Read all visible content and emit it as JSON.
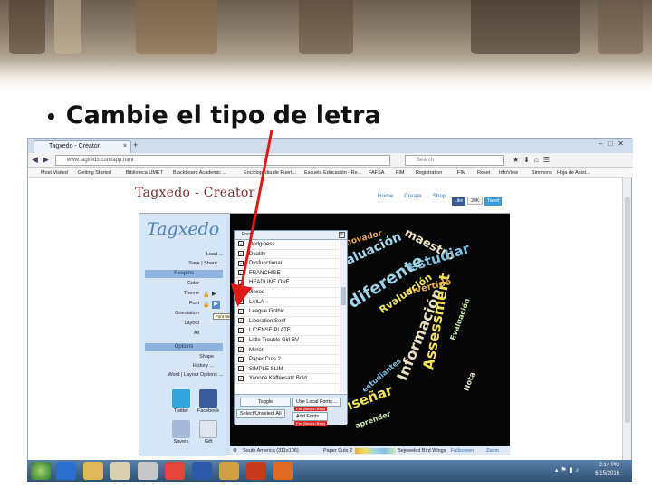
{
  "slide": {
    "bullet": "•",
    "title": "Cambie el tipo de letra"
  },
  "browser": {
    "tab_title": "Tagxedo - Creator",
    "tab_close": "×",
    "new_tab": "+",
    "url": "www.tagxedo.com/app.html",
    "search_placeholder": "Search",
    "bookmarks": [
      "Most Visited",
      "Getting Started",
      "Biblioteca UMET",
      "Blackboard Academic ...",
      "Enciclopedia de Puert...",
      "Escuela Educación - Re...",
      "FAFSA",
      "FIM",
      "Registration",
      "FIM",
      "Reset",
      "InfoView",
      "Simmons",
      "Hoja de Asist..."
    ]
  },
  "site": {
    "logo": "Tagxedo - Creator",
    "nav": [
      "Home",
      "Create",
      "Shop"
    ],
    "social": [
      "Like",
      "20K",
      "Tweet"
    ]
  },
  "app": {
    "logo": "Tagxedo",
    "menu_top": [
      "Load ...",
      "Save | Share ..."
    ],
    "section_respins": "Respins",
    "respins": [
      "Color",
      "Theme",
      "Font",
      "Orientation",
      "Layout",
      "All"
    ],
    "section_options": "Options",
    "options": [
      "Shape",
      "History ...",
      "Word | Layout Options ..."
    ],
    "icons": [
      "Twitter",
      "Facebook",
      "Savers",
      "Gift"
    ],
    "tooltip": "Font Menu",
    "font_menu": {
      "header": "Fonts",
      "close": "×",
      "fonts": [
        "Dodginess",
        "Duality",
        "Dysfunctional",
        "FRANCHISE",
        "HEADLINE ONE",
        "Jinxed",
        "LAILA",
        "League Gothic",
        "Liberation Serif",
        "LICENSE PLATE",
        "Little Trouble Girl BV",
        "Mirror",
        "Paper Cuts 2",
        "SIMPLE SLIM",
        "Yanone Kaffeesatz Bold"
      ],
      "toggle": "Toggle",
      "select_unselect": "Select/Unselect All",
      "use_local": "Use Local Fonts ...",
      "add_fonts": "Add Fonts ...",
      "red_note1": "Fan (Best in Beta)",
      "red_note2": "Fan (Best in Beta)"
    },
    "status": {
      "shape": "South America (311x106)",
      "font": "Paper Cuts 2",
      "theme": "Bejeweled Bird Wings",
      "fullscreen": "Fullscreen",
      "zoom": "Zoom"
    }
  },
  "cloud_words": [
    "maestro",
    "estudiar",
    "evaluación",
    "diferente",
    "Información",
    "Assessment",
    "divertido",
    "ehseñar",
    "Evaluación",
    "innovador",
    "aprender",
    "Rvaluación",
    "estudiantes",
    "Nota"
  ],
  "taskbar": {
    "time": "2:14 PM",
    "date": "6/15/2016"
  },
  "colors": {
    "title": "#111111",
    "arrow": "#e01818",
    "accent": "#4b82b8",
    "wordcloud": [
      "#9fd4e8",
      "#f0e05a",
      "#e8a94a",
      "#c8e8b0",
      "#7fc0e0",
      "#e8e0c0"
    ]
  }
}
